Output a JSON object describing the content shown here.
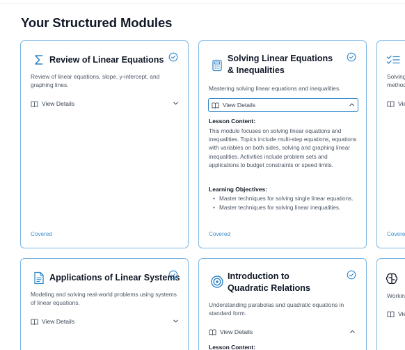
{
  "page": {
    "title": "Your Structured Modules"
  },
  "cards": [
    {
      "title": "Review of Linear Equations",
      "icon": "sigma-icon",
      "description": "Review of linear equations, slope, y-intercept, and graphing lines.",
      "details_label": "View Details",
      "status": "Covered"
    },
    {
      "title": "Solving Linear Equations & Inequalities",
      "icon": "calculator-icon",
      "description": "Mastering solving linear equations and inequalities.",
      "details_label": "View Details",
      "lesson_heading": "Lesson Content:",
      "lesson_text": "This module focuses on solving linear equations and inequalities. Topics include multi-step equations, equations with variables on both sides, solving and graphing linear inequalities. Activities include problem sets and applications to budget constraints or speed limits.",
      "objectives_heading": "Learning Objectives:",
      "objectives": [
        "Master techniques for solving single linear equations.",
        "Master techniques for solving linear inequalities."
      ],
      "status": "Covered"
    },
    {
      "title": "",
      "icon": "checklist-icon",
      "description": "Solving\nmethod",
      "details_label": "Vie",
      "status": "Covere"
    },
    {
      "title": "Applications of Linear Systems",
      "icon": "document-icon",
      "description": "Modeling and solving real-world problems using systems of linear equations.",
      "details_label": "View Details"
    },
    {
      "title": "Introduction to Quadratic Relations",
      "icon": "target-icon",
      "description": "Understanding parabolas and quadratic equations in standard form.",
      "details_label": "View Details",
      "lesson_heading": "Lesson Content:"
    },
    {
      "title": "",
      "icon": "brain-icon",
      "description": "Workin",
      "details_label": "Vie"
    }
  ],
  "colors": {
    "accent": "#2f86c9",
    "border": "#7cb7e4",
    "covered": "#3b8fd1"
  }
}
